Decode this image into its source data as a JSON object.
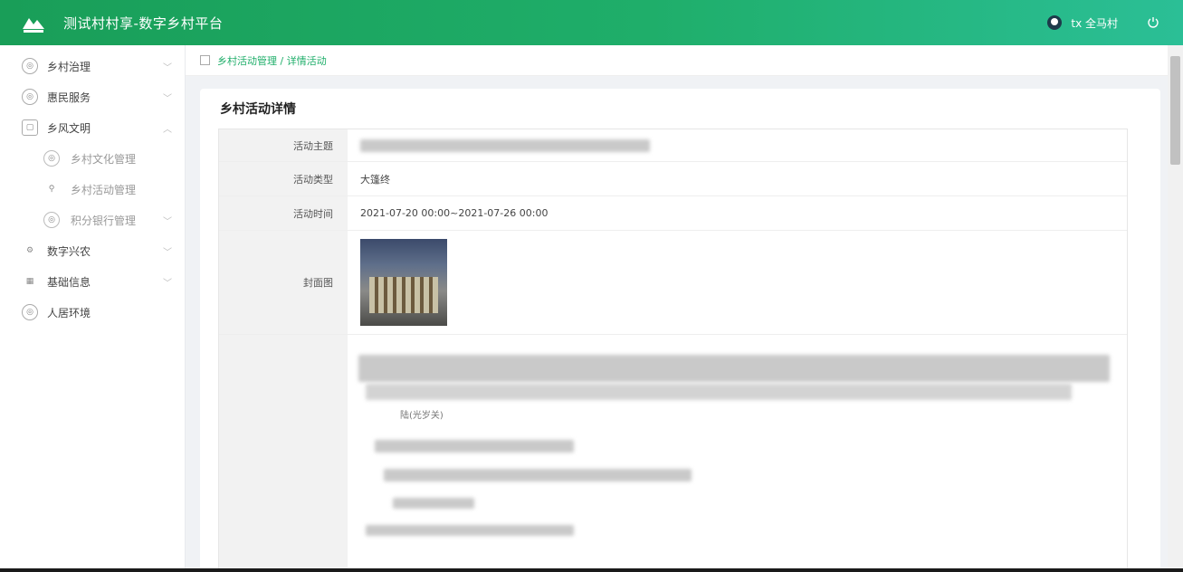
{
  "app": {
    "title": "测试村村享-数字乡村平台",
    "user": "tx 全马村"
  },
  "sidebar": {
    "items": [
      {
        "label": "乡村治理",
        "icon": "circle-icon",
        "has_chevron": true
      },
      {
        "label": "惠民服务",
        "icon": "circle-icon",
        "has_chevron": true
      },
      {
        "label": "乡风文明",
        "icon": "square-icon",
        "has_chevron": true
      },
      {
        "label": "乡村文化管理",
        "icon": "circle-icon",
        "sub": true
      },
      {
        "label": "乡村活动管理",
        "icon": "pin-icon",
        "sub": true
      },
      {
        "label": "积分银行管理",
        "icon": "circle-icon",
        "sub": true,
        "has_chevron": true
      },
      {
        "label": "数字兴农",
        "icon": "gear-icon",
        "has_chevron": true
      },
      {
        "label": "基础信息",
        "icon": "building-icon",
        "has_chevron": true
      },
      {
        "label": "人居环境",
        "icon": "circle-icon"
      }
    ]
  },
  "breadcrumb": {
    "text": "乡村活动管理 / 详情活动"
  },
  "detail": {
    "title": "乡村活动详情",
    "rows": [
      {
        "label": "活动主题",
        "value": ""
      },
      {
        "label": "活动类型",
        "value": "大篷终"
      },
      {
        "label": "活动时间",
        "value": "2021-07-20 00:00~2021-07-26 00:00"
      },
      {
        "label": "封面图",
        "value": ""
      }
    ],
    "body_fragment": "陆(光岁关)"
  },
  "colors": {
    "accent": "#1fae6a",
    "topbar_end": "#2bbf96"
  }
}
